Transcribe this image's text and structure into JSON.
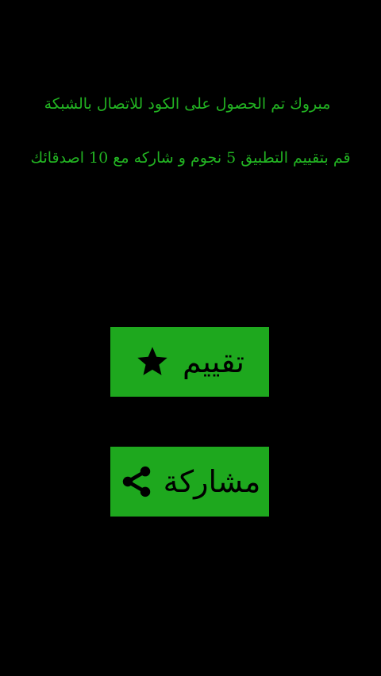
{
  "message": {
    "line1": "مبروك تم الحصول على الكود للاتصال بالشبكة",
    "line2": "قم بتقييم التطبيق 5 نجوم و شاركه مع 10 اصدقائك"
  },
  "buttons": {
    "rate": {
      "label": "تقييم",
      "icon": "star-icon"
    },
    "share": {
      "label": "مشاركة",
      "icon": "share-icon"
    }
  },
  "colors": {
    "background": "#000000",
    "message_text": "#22b322",
    "button_background": "#1ea81e",
    "button_text": "#000000"
  }
}
